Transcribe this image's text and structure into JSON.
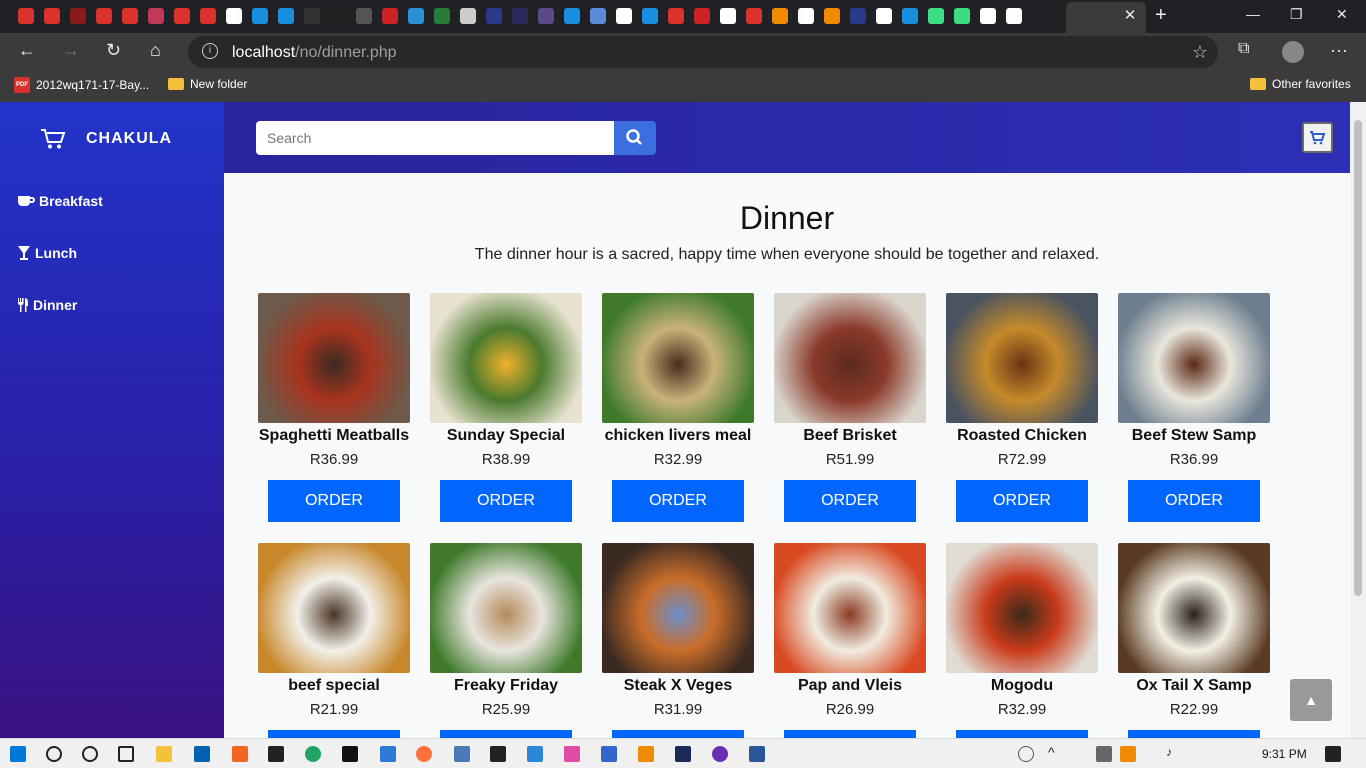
{
  "browser": {
    "url_host": "localhost",
    "url_path": "/no/dinner.php",
    "favorites": [
      {
        "label": "2012wq171-17-Bay..."
      },
      {
        "label": "New folder"
      },
      {
        "label": "Other favorites"
      }
    ]
  },
  "app": {
    "brand": "CHAKULA",
    "nav": [
      {
        "label": "Breakfast",
        "icon": "coffee-icon"
      },
      {
        "label": "Lunch",
        "icon": "cocktail-icon"
      },
      {
        "label": "Dinner",
        "icon": "utensils-icon"
      }
    ],
    "search_placeholder": "Search"
  },
  "page": {
    "title": "Dinner",
    "subtitle": "The dinner hour is a sacred, happy time when everyone should be together and relaxed.",
    "order_label": "ORDER",
    "items": [
      {
        "name": "Spaghetti Meatballs",
        "price": "R36.99",
        "colors": [
          "#3b2a22",
          "#a8341f",
          "#6d5a4a"
        ]
      },
      {
        "name": "Sunday Special",
        "price": "R38.99",
        "colors": [
          "#f0b12b",
          "#4b7a2e",
          "#e8e2d0"
        ]
      },
      {
        "name": "chicken livers meal",
        "price": "R32.99",
        "colors": [
          "#4a2c1d",
          "#c9b27a",
          "#3f7a2b"
        ]
      },
      {
        "name": "Beef Brisket",
        "price": "R51.99",
        "colors": [
          "#5a2a1e",
          "#8a3a2a",
          "#d9d4cc"
        ]
      },
      {
        "name": "Roasted Chicken",
        "price": "R72.99",
        "colors": [
          "#6a3414",
          "#c58a2a",
          "#4a5360"
        ]
      },
      {
        "name": "Beef Stew Samp",
        "price": "R36.99",
        "colors": [
          "#5a2814",
          "#e9e6dc",
          "#6d7f8f"
        ]
      },
      {
        "name": "beef special",
        "price": "R21.99",
        "colors": [
          "#4a3424",
          "#f2f0ea",
          "#c7872a"
        ]
      },
      {
        "name": "Freaky Friday",
        "price": "R25.99",
        "colors": [
          "#b58a5a",
          "#e8e4de",
          "#3f7a2b"
        ]
      },
      {
        "name": "Steak X Veges",
        "price": "R31.99",
        "colors": [
          "#6c8fc9",
          "#c96d2a",
          "#3a2a22"
        ]
      },
      {
        "name": "Pap and Vleis",
        "price": "R26.99",
        "colors": [
          "#8a3a22",
          "#f0ece0",
          "#d94a22"
        ]
      },
      {
        "name": "Mogodu",
        "price": "R32.99",
        "colors": [
          "#3a2a1a",
          "#c93a1a",
          "#e0dcd4"
        ]
      },
      {
        "name": "Ox Tail X Samp",
        "price": "R22.99",
        "colors": [
          "#2a2018",
          "#f2efe4",
          "#5a3a22"
        ]
      }
    ]
  },
  "taskbar": {
    "time": "9:31 PM"
  }
}
